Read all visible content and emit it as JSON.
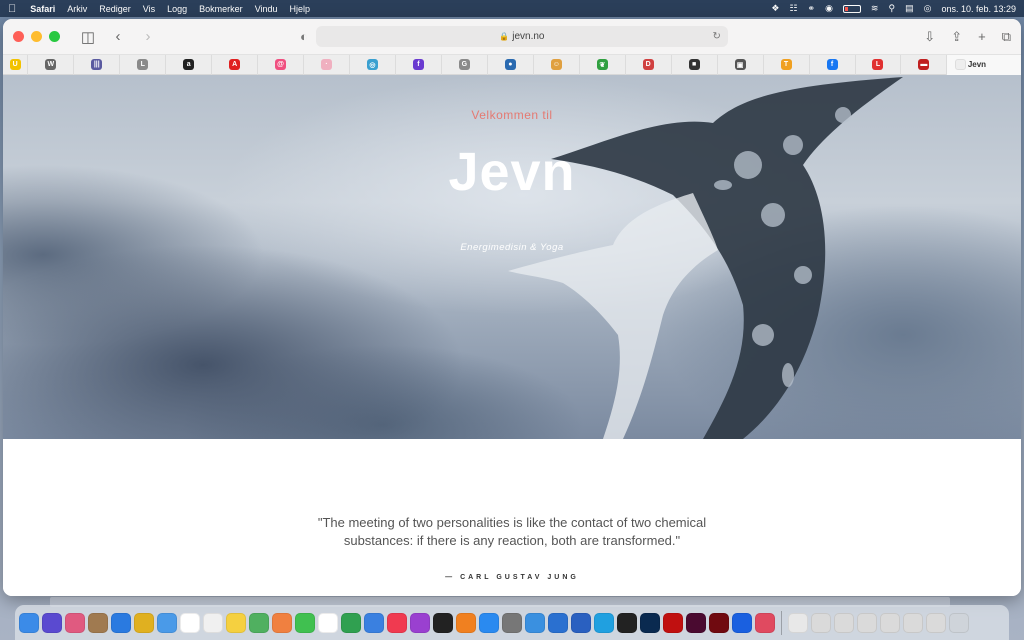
{
  "menubar": {
    "items": [
      "Safari",
      "Arkiv",
      "Rediger",
      "Vis",
      "Logg",
      "Bokmerker",
      "Vindu",
      "Hjelp"
    ],
    "clock": "ons. 10. feb.  13:29"
  },
  "browser": {
    "url": "jevn.no",
    "active_tab": "Jevn",
    "favorites": [
      {
        "name": "u-favicon",
        "letter": "U",
        "color": "#f2c200"
      },
      {
        "name": "wordpress-favicon",
        "letter": "W",
        "color": "#666666"
      },
      {
        "name": "bars-favicon",
        "letter": "|||",
        "color": "#5a5aa0"
      },
      {
        "name": "l-favicon",
        "letter": "L",
        "color": "#8a8a8a"
      },
      {
        "name": "amazon-favicon",
        "letter": "a",
        "color": "#222222"
      },
      {
        "name": "adobe-favicon",
        "letter": "A",
        "color": "#e02020"
      },
      {
        "name": "spiral-favicon",
        "letter": "@",
        "color": "#f05080"
      },
      {
        "name": "pink-favicon",
        "letter": "·",
        "color": "#f0b0c0"
      },
      {
        "name": "compass-favicon",
        "letter": "◎",
        "color": "#3aa0d0"
      },
      {
        "name": "f-favicon",
        "letter": "f",
        "color": "#6a3ad0"
      },
      {
        "name": "g-favicon",
        "letter": "G",
        "color": "#8a8a8a"
      },
      {
        "name": "globe-favicon",
        "letter": "●",
        "color": "#2a6ab0"
      },
      {
        "name": "face-favicon",
        "letter": "☺",
        "color": "#e0a040"
      },
      {
        "name": "leaf-favicon",
        "letter": "❦",
        "color": "#30a040"
      },
      {
        "name": "dhl-favicon",
        "letter": "D",
        "color": "#d04040"
      },
      {
        "name": "square-favicon",
        "letter": "■",
        "color": "#333333"
      },
      {
        "name": "photo-favicon",
        "letter": "▣",
        "color": "#555555"
      },
      {
        "name": "t-favicon",
        "letter": "T",
        "color": "#f0a020"
      },
      {
        "name": "facebook-favicon",
        "letter": "f",
        "color": "#1877f2"
      },
      {
        "name": "l-red-favicon",
        "letter": "L",
        "color": "#e03030"
      },
      {
        "name": "red-square-favicon",
        "letter": "▬",
        "color": "#c02020"
      }
    ]
  },
  "hero": {
    "pre_title": "Velkommen til",
    "title": "Jevn",
    "subtitle": "Energimedisin & Yoga"
  },
  "quote": {
    "line1": "\"The meeting of two personalities is like the contact of two chemical",
    "line2": "substances: if there is any reaction, both are transformed.\"",
    "author": "— CARL GUSTAV JUNG"
  },
  "dock": {
    "icons": [
      {
        "name": "finder-icon",
        "color": "#3b8be8"
      },
      {
        "name": "siri-icon",
        "color": "#5a4ad0"
      },
      {
        "name": "launchpad-icon",
        "color": "#e05a80"
      },
      {
        "name": "archive-icon",
        "color": "#a07a50"
      },
      {
        "name": "safari-icon",
        "color": "#2a7ae0"
      },
      {
        "name": "chrome-icon",
        "color": "#e0b020"
      },
      {
        "name": "mail-icon",
        "color": "#4a9ae8"
      },
      {
        "name": "calendar-icon",
        "color": "#ffffff"
      },
      {
        "name": "reminders-icon",
        "color": "#f0f0f0"
      },
      {
        "name": "notes-icon",
        "color": "#f5d040"
      },
      {
        "name": "maps-icon",
        "color": "#50b060"
      },
      {
        "name": "photos-icon",
        "color": "#f08040"
      },
      {
        "name": "messages-icon",
        "color": "#40c050"
      },
      {
        "name": "freeform-icon",
        "color": "#ffffff"
      },
      {
        "name": "numbers-icon",
        "color": "#30a050"
      },
      {
        "name": "keynote-icon",
        "color": "#3a80e0"
      },
      {
        "name": "music-icon",
        "color": "#f03a50"
      },
      {
        "name": "podcasts-icon",
        "color": "#9a40d0"
      },
      {
        "name": "tv-icon",
        "color": "#222222"
      },
      {
        "name": "books-icon",
        "color": "#f08020"
      },
      {
        "name": "appstore-icon",
        "color": "#2a8af0"
      },
      {
        "name": "settings-icon",
        "color": "#777777"
      },
      {
        "name": "network-icon",
        "color": "#3a90e0"
      },
      {
        "name": "screen-add-icon",
        "color": "#2a70d0"
      },
      {
        "name": "screen-share-icon",
        "color": "#2a60c0"
      },
      {
        "name": "skype-icon",
        "color": "#20a0e0"
      },
      {
        "name": "terminal-icon",
        "color": "#222222"
      },
      {
        "name": "photoshop-icon",
        "color": "#0a2a50"
      },
      {
        "name": "acrobat-icon",
        "color": "#c01010"
      },
      {
        "name": "indesign-icon",
        "color": "#4a0a30"
      },
      {
        "name": "flash-icon",
        "color": "#700a10"
      },
      {
        "name": "dropbox-icon",
        "color": "#1a60e0"
      },
      {
        "name": "creative-cloud-icon",
        "color": "#e04a60"
      },
      {
        "name": "doc-icon",
        "color": "#e8e8e8"
      },
      {
        "name": "window-1-icon",
        "color": "#dadada"
      },
      {
        "name": "window-2-icon",
        "color": "#dadada"
      },
      {
        "name": "window-3-icon",
        "color": "#dadada"
      },
      {
        "name": "window-4-icon",
        "color": "#dadada"
      },
      {
        "name": "window-5-icon",
        "color": "#dadada"
      },
      {
        "name": "window-6-icon",
        "color": "#dadada"
      },
      {
        "name": "trash-icon",
        "color": "#cfd4da"
      }
    ]
  }
}
